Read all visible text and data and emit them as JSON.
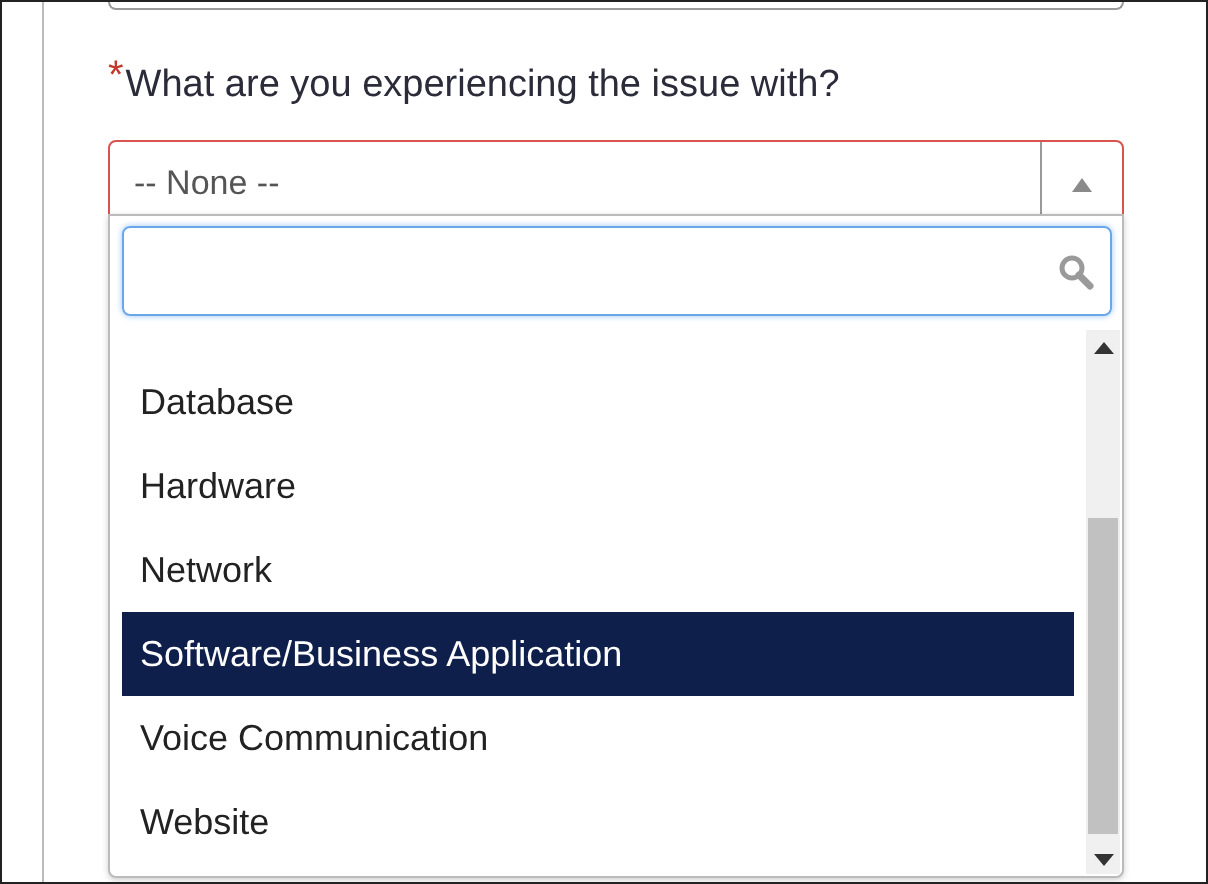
{
  "question": {
    "required_mark": "*",
    "label": "What are you experiencing the issue with?"
  },
  "select": {
    "value": "-- None --",
    "expanded": true
  },
  "dropdown": {
    "options": [
      {
        "label": "Database",
        "selected": false
      },
      {
        "label": "Hardware",
        "selected": false
      },
      {
        "label": "Network",
        "selected": false
      },
      {
        "label": "Software/Business Application",
        "selected": true
      },
      {
        "label": "Voice Communication",
        "selected": false
      },
      {
        "label": "Website",
        "selected": false
      }
    ]
  }
}
